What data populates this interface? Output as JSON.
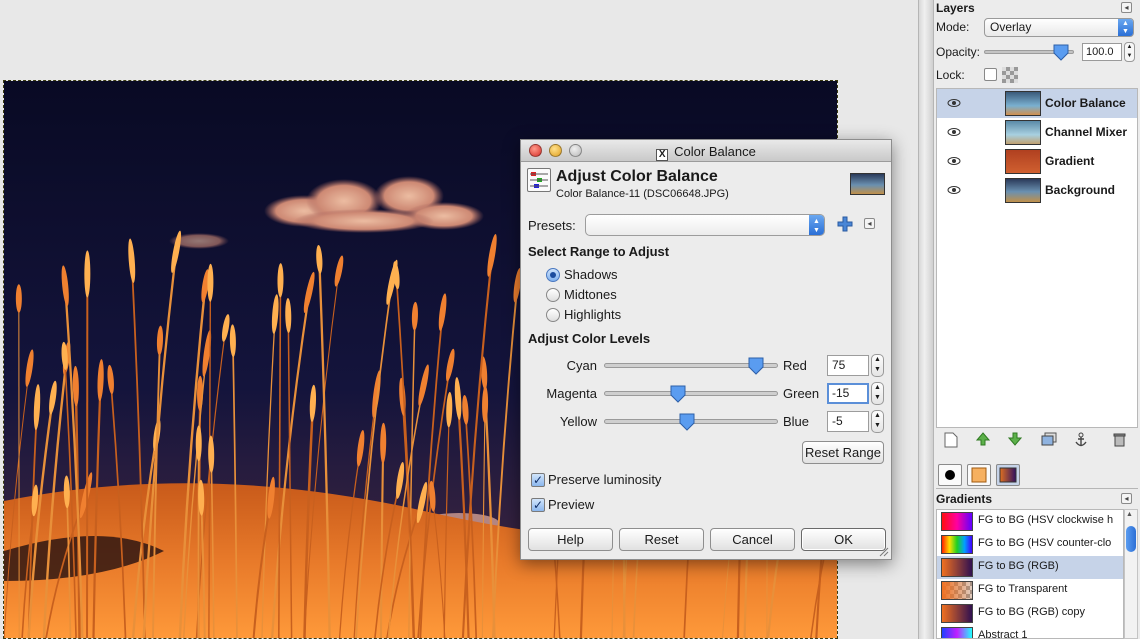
{
  "colors": {
    "accent": "#3a7be0",
    "selection": "#c6d3e8",
    "sky": "#0c0e2e",
    "grass": "#e57d2a"
  },
  "layers_panel": {
    "title": "Layers",
    "mode_label": "Mode:",
    "mode_value": "Overlay",
    "opacity_label": "Opacity:",
    "opacity_value": "100.0",
    "opacity_fraction": 0.85,
    "lock_label": "Lock:",
    "layers": [
      {
        "name": "Color Balance",
        "selected": true
      },
      {
        "name": "Channel Mixer",
        "selected": false
      },
      {
        "name": "Gradient",
        "selected": false
      },
      {
        "name": "Background",
        "selected": false
      }
    ],
    "toolbar_icons": [
      "new-layer-icon",
      "raise-layer-icon",
      "lower-layer-icon",
      "duplicate-layer-icon",
      "anchor-layer-icon",
      "delete-layer-icon"
    ]
  },
  "gradients_panel": {
    "title": "Gradients",
    "items": [
      {
        "name": "FG to BG (HSV clockwise h",
        "selected": false
      },
      {
        "name": "FG to BG (HSV counter-clo",
        "selected": false
      },
      {
        "name": "FG to BG (RGB)",
        "selected": true
      },
      {
        "name": "FG to Transparent",
        "selected": false
      },
      {
        "name": "FG to BG (RGB) copy",
        "selected": false
      },
      {
        "name": "Abstract 1",
        "selected": false
      }
    ]
  },
  "dialog": {
    "window_title": "Color Balance",
    "heading": "Adjust Color Balance",
    "subheading": "Color Balance-11 (DSC06648.JPG)",
    "presets_label": "Presets:",
    "presets_value": "",
    "range_section": "Select Range to Adjust",
    "ranges": [
      {
        "label": "Shadows",
        "selected": true
      },
      {
        "label": "Midtones",
        "selected": false
      },
      {
        "label": "Highlights",
        "selected": false
      }
    ],
    "levels_section": "Adjust Color Levels",
    "levels": [
      {
        "left": "Cyan",
        "right": "Red",
        "value": "75",
        "num": 75
      },
      {
        "left": "Magenta",
        "right": "Green",
        "value": "-15",
        "num": -15
      },
      {
        "left": "Yellow",
        "right": "Blue",
        "value": "-5",
        "num": -5
      }
    ],
    "level_range": [
      -100,
      100
    ],
    "reset_range_label": "Reset Range",
    "preserve_luminosity_label": "Preserve luminosity",
    "preserve_luminosity_checked": true,
    "preview_label": "Preview",
    "preview_checked": true,
    "buttons": {
      "help": "Help",
      "reset": "Reset",
      "cancel": "Cancel",
      "ok": "OK"
    }
  }
}
